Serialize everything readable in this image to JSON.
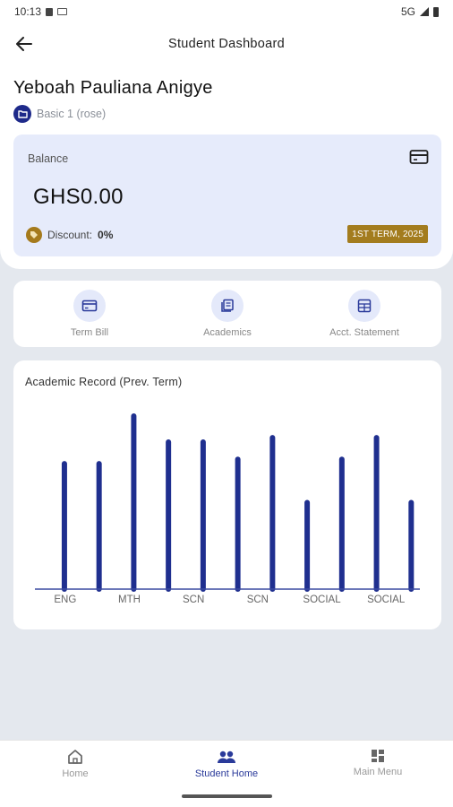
{
  "status_bar": {
    "time": "10:13",
    "network": "5G"
  },
  "app_bar": {
    "title": "Student Dashboard"
  },
  "student": {
    "name": "Yeboah Pauliana Anigye",
    "class": "Basic 1 (rose)"
  },
  "balance_card": {
    "label": "Balance",
    "amount": "GHS0.00",
    "discount_label": "Discount:",
    "discount_value": "0%",
    "term_badge": "1ST TERM, 2025"
  },
  "actions": [
    {
      "label": "Term Bill",
      "icon": "bill-icon"
    },
    {
      "label": "Academics",
      "icon": "academics-icon"
    },
    {
      "label": "Acct. Statement",
      "icon": "statement-icon"
    }
  ],
  "academic_chart": {
    "title": "Academic Record (Prev. Term)"
  },
  "chart_data": {
    "type": "bar",
    "title": "Academic Record (Prev. Term)",
    "tick_labels": [
      "ENG",
      "MTH",
      "SCN",
      "SCN",
      "SOCIAL",
      "SOCIAL"
    ],
    "values": [
      58,
      58,
      80,
      68,
      68,
      60,
      70,
      40,
      60,
      70,
      40
    ],
    "ylim": [
      0,
      80
    ],
    "grid": false,
    "bar_color": "#1f2f8f"
  },
  "bottom_nav": [
    {
      "label": "Home",
      "icon": "home-icon",
      "active": false
    },
    {
      "label": "Student Home",
      "icon": "people-icon",
      "active": true
    },
    {
      "label": "Main Menu",
      "icon": "grid-icon",
      "active": false
    }
  ],
  "colors": {
    "primary": "#1e2a8a",
    "accent_gold": "#a37c1e",
    "card_bg": "#e6ebfb",
    "page_bg": "#e4e8ee"
  }
}
